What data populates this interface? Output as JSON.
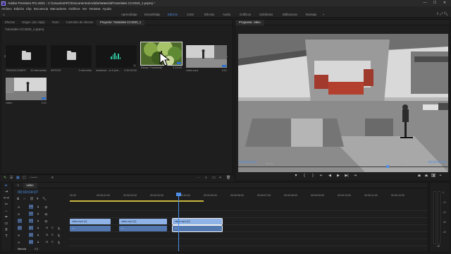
{
  "window": {
    "title": "Adobe Premiere Pro 2021 - C:\\Usuarios\\PC\\Documentos\\Adobe\\Material\\Tutoriales CC2020_1.prproj *",
    "app_badge": "Pr",
    "controls": [
      "—",
      "☐",
      "✕"
    ]
  },
  "menu": [
    "Archivo",
    "Edición",
    "Clip",
    "Secuencia",
    "Marcadores",
    "Gráficos",
    "Ver",
    "Ventana",
    "Ayuda"
  ],
  "workspaces": {
    "items": [
      "Aprendizaje",
      "Ensamblaje",
      "Edición",
      "Color",
      "Efectos",
      "Audio",
      "Gráficos",
      "Subtítulos",
      "Bibliotecas",
      "Montaje"
    ],
    "active": "Edición",
    "home_icon": "home-icon",
    "more": "»"
  },
  "project_panel": {
    "tabs": [
      "Efectos",
      "Origen: (sin clips)",
      "Texto",
      "Controles de efectos",
      "Proyecto: Tutoriales CC2020_1"
    ],
    "active_tab": "Proyecto: Tutoriales CC2020_1",
    "path": "Tutoriales CC2020_1.prproj",
    "selection_count": "1 de 6 elementos seleccionados",
    "items": [
      {
        "type": "folder",
        "name": "TRANSICIONES",
        "meta": "10 elementos"
      },
      {
        "type": "folder",
        "name": "INTROS",
        "meta": "1 elemento"
      },
      {
        "type": "audio",
        "name": "lookbook - lo-fi (lim...",
        "meta": "2:30:00:00"
      },
      {
        "type": "video-tree",
        "name": "Estasc Thumbnail",
        "meta": "4:16:00",
        "selected": true
      },
      {
        "type": "video-skate",
        "name": "video.mp4",
        "meta": "3:21"
      },
      {
        "type": "video-skate2",
        "name": "video",
        "meta": "3:21"
      }
    ]
  },
  "program_monitor": {
    "tab": "Programa: video",
    "timecode_left": "00:00:04:07",
    "fit": "Ajustar",
    "ratio": "1/1",
    "timecode_right": "00:00:05:23",
    "controls": [
      "▼",
      "{",
      "}",
      "⇤",
      "◀",
      "▶",
      "▶|",
      "⇥"
    ]
  },
  "timeline": {
    "tab": "video",
    "timecode": "00:00:04:07",
    "ruler": [
      "00:00",
      "00:00:01:00",
      "00:00:02:00",
      "00:00:03:00",
      "00:00:04:00",
      "00:00:05:00",
      "00:00:06:00",
      "00:00:07:00",
      "00:00:08:00",
      "00:00:09:00",
      "00:00:10:00",
      "00:00:11:00",
      "00:00:12:00"
    ],
    "tracks": [
      {
        "label": "V3"
      },
      {
        "label": "V2"
      },
      {
        "label": "V1"
      },
      {
        "label": "A1"
      },
      {
        "label": "A2"
      },
      {
        "label": "A3"
      }
    ],
    "clips_v1": [
      "video.mp4 [V]",
      "video.mp4 [V]",
      "video.mp4 [V]"
    ],
    "mix_label": "Mezcla",
    "mix_value": "0,0"
  },
  "meters": {
    "scale": [
      "0",
      "-12",
      "-24",
      "-36",
      "-48",
      "dB"
    ]
  },
  "colors": {
    "accent": "#4e8fe8",
    "work_area": "#c8b63b",
    "clip_video": "#8fb3e6",
    "clip_audio": "#5378b0"
  }
}
